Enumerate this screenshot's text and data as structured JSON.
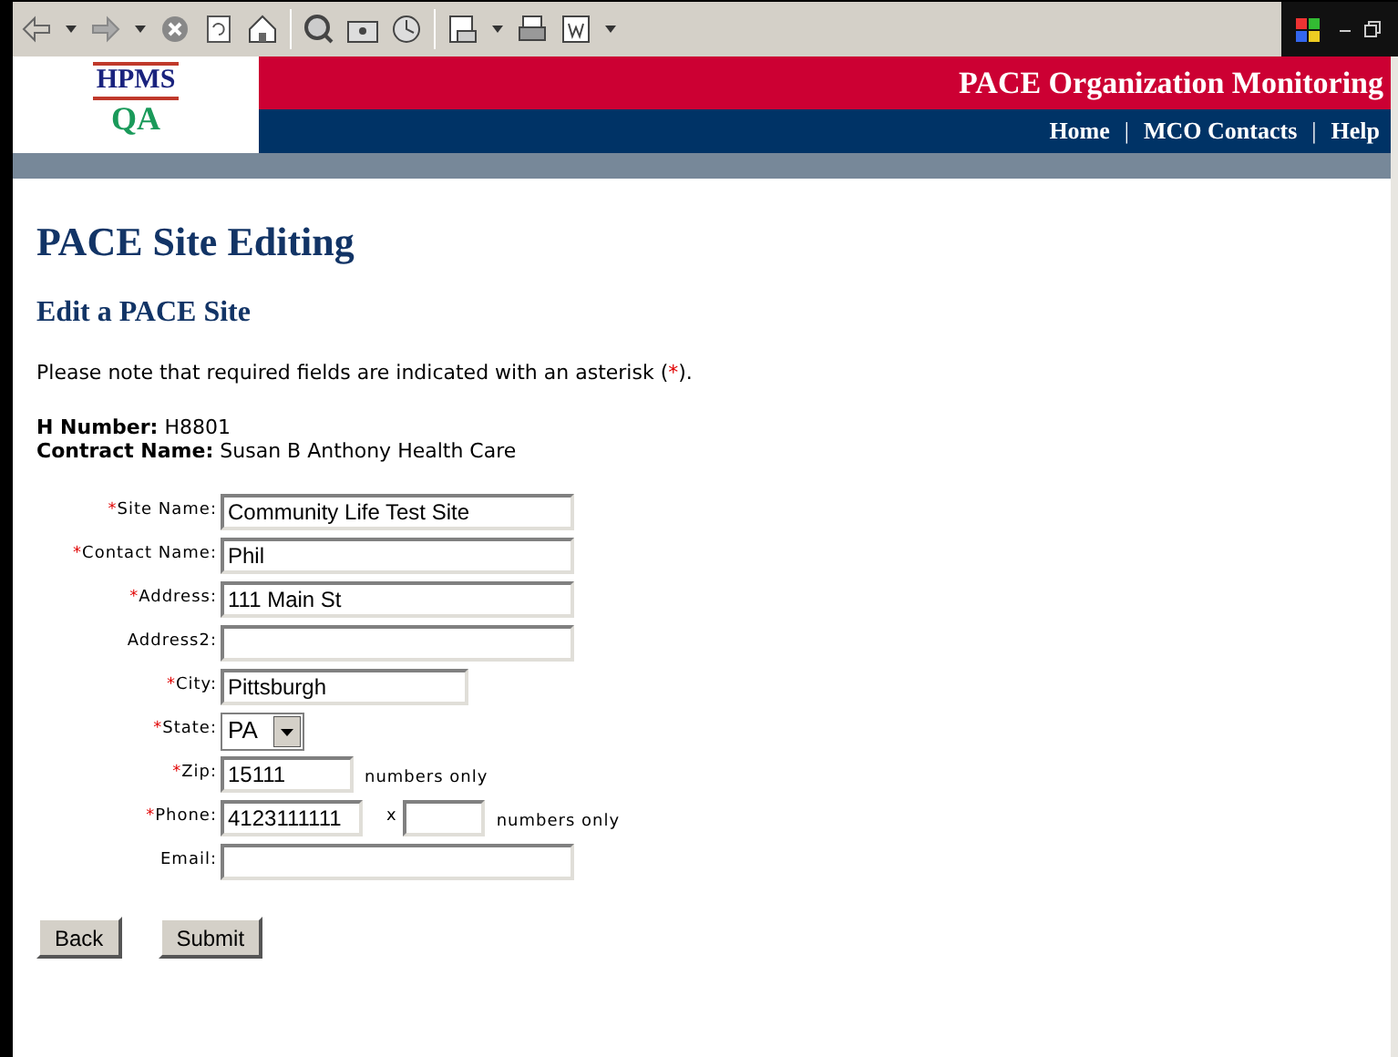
{
  "header": {
    "logo_top": "HPMS",
    "logo_bottom": "QA",
    "title": "PACE Organization Monitoring",
    "nav": [
      {
        "label": "Home"
      },
      {
        "label": "MCO Contacts"
      },
      {
        "label": "Help"
      }
    ],
    "separator": "|"
  },
  "page_title": "PACE Site Editing",
  "section_title": "Edit a PACE Site",
  "note_parts": [
    "Please note that required fields are indicated with an asterisk (",
    "*",
    ")."
  ],
  "info": [
    {
      "label": "H Number:",
      "value": "H8801"
    },
    {
      "label": "Contract Name:",
      "value": "Susan B Anthony Health Care"
    }
  ],
  "fields": [
    {
      "kind": "long_text",
      "label": "Site Name:",
      "required": true,
      "value": "Community Life Test Site"
    },
    {
      "kind": "long_text",
      "label": "Contact Name:",
      "required": true,
      "value": "Phil"
    },
    {
      "kind": "long_text",
      "label": "Address:",
      "required": true,
      "value": "111 Main St"
    },
    {
      "kind": "long_text",
      "label": "Address2:",
      "required": false
    },
    {
      "kind": "medium_text",
      "label": "City:",
      "required": true,
      "value": "Pittsburgh"
    },
    {
      "kind": "select",
      "label": "State:",
      "required": true,
      "value": "PA"
    },
    {
      "kind": "short_text",
      "label": "Zip:",
      "required": true,
      "value": "15111",
      "hint": "numbers only"
    },
    {
      "kind": "phone",
      "label": "Phone:",
      "required": true,
      "value": "4123111111",
      "ext_label": "x",
      "hint": "numbers only"
    },
    {
      "kind": "long_text",
      "label": "Email:",
      "required": false
    }
  ],
  "asterisk": "*",
  "buttons": [
    {
      "label": "Back"
    },
    {
      "label": "Submit"
    }
  ]
}
